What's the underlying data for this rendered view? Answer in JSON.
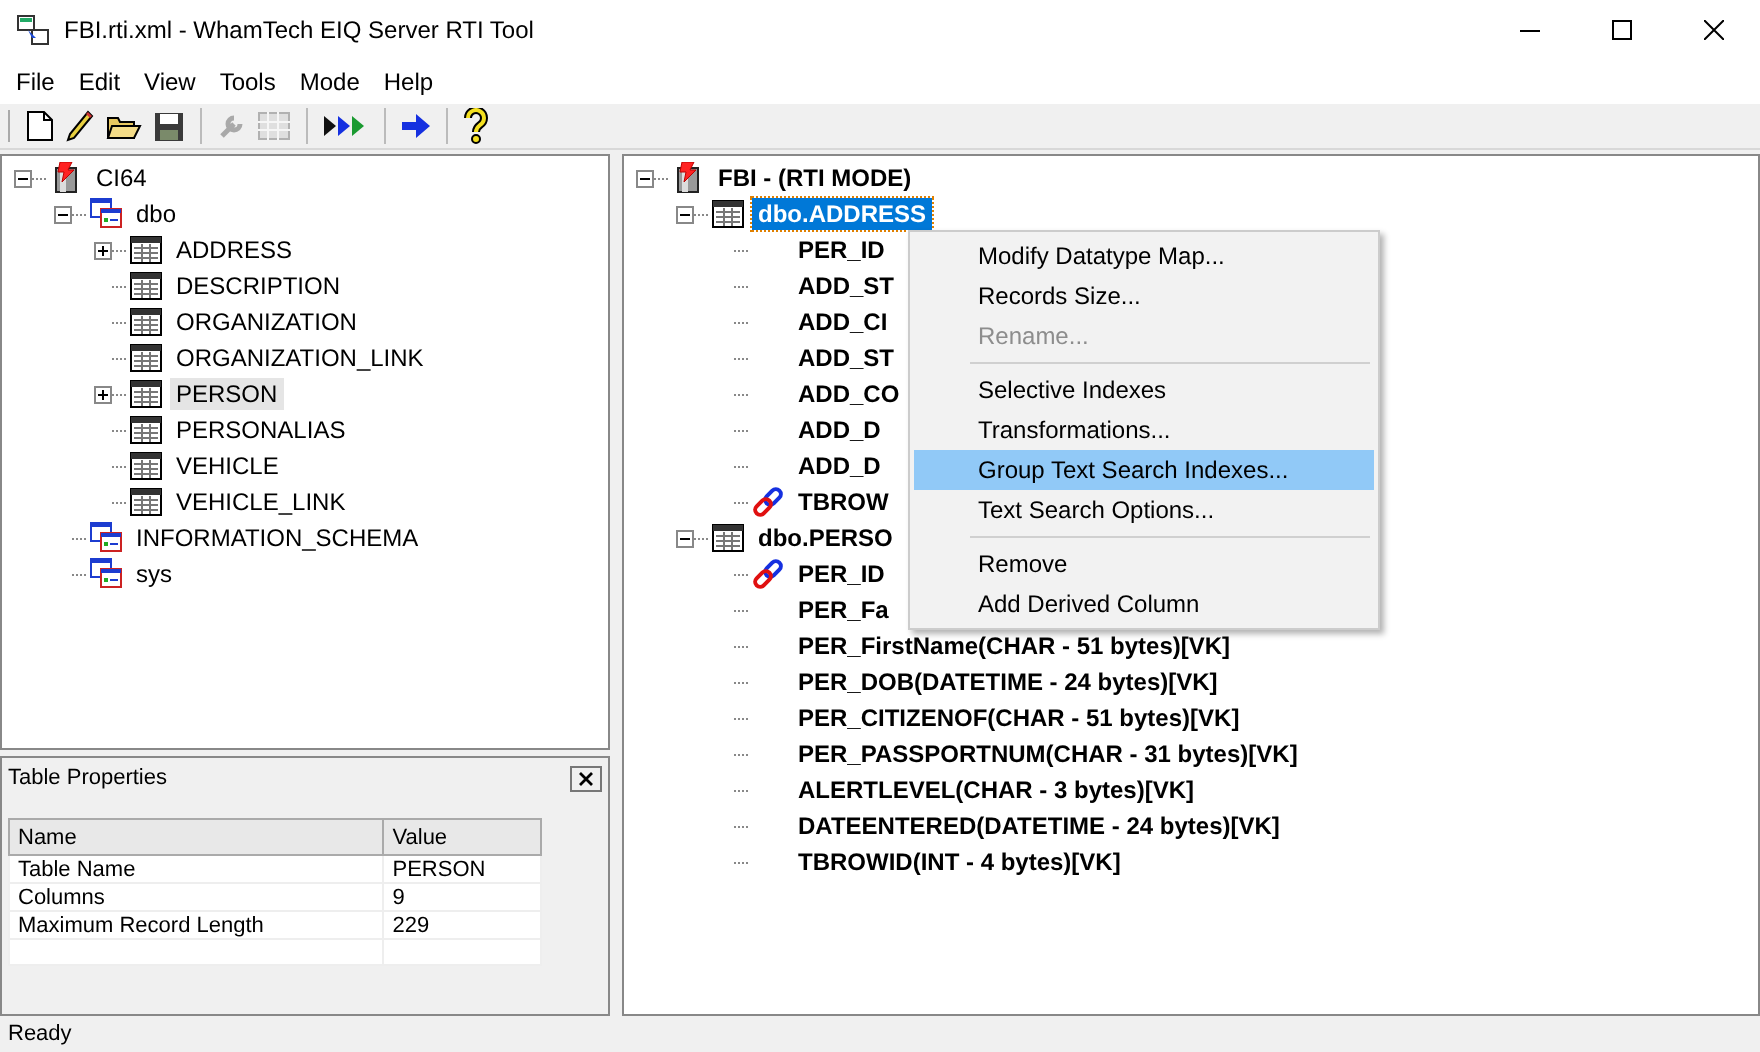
{
  "window": {
    "title": "FBI.rti.xml - WhamTech EIQ Server RTI Tool"
  },
  "menu_bar": [
    "File",
    "Edit",
    "View",
    "Tools",
    "Mode",
    "Help"
  ],
  "toolbar": [
    {
      "kind": "new",
      "disabled": false
    },
    {
      "kind": "edit",
      "disabled": false
    },
    {
      "kind": "open",
      "disabled": false
    },
    {
      "kind": "save",
      "disabled": false
    },
    {
      "kind": "sep"
    },
    {
      "kind": "wrench",
      "disabled": true
    },
    {
      "kind": "grid",
      "disabled": true
    },
    {
      "kind": "sep"
    },
    {
      "kind": "run-all",
      "disabled": false
    },
    {
      "kind": "sep"
    },
    {
      "kind": "run",
      "disabled": false
    },
    {
      "kind": "sep"
    },
    {
      "kind": "help",
      "disabled": false
    }
  ],
  "left_tree": [
    {
      "label": "CI64",
      "kind": "database",
      "expanded": true,
      "selected": false,
      "children": [
        {
          "label": "dbo",
          "kind": "schema",
          "expanded": true,
          "selected": false,
          "children": [
            {
              "label": "ADDRESS",
              "kind": "table",
              "expanded": false,
              "selected": false
            },
            {
              "label": "DESCRIPTION",
              "kind": "table",
              "selected": false
            },
            {
              "label": "ORGANIZATION",
              "kind": "table",
              "selected": false
            },
            {
              "label": "ORGANIZATION_LINK",
              "kind": "table",
              "selected": false
            },
            {
              "label": "PERSON",
              "kind": "table",
              "expanded": false,
              "selected": true
            },
            {
              "label": "PERSONALIAS",
              "kind": "table",
              "selected": false
            },
            {
              "label": "VEHICLE",
              "kind": "table",
              "selected": false
            },
            {
              "label": "VEHICLE_LINK",
              "kind": "table",
              "selected": false
            }
          ]
        },
        {
          "label": "INFORMATION_SCHEMA",
          "kind": "schema",
          "selected": false
        },
        {
          "label": "sys",
          "kind": "schema",
          "selected": false
        }
      ]
    }
  ],
  "properties_panel": {
    "title": "Table Properties",
    "columns": [
      "Name",
      "Value"
    ],
    "rows": [
      [
        "Table Name",
        "PERSON"
      ],
      [
        "Columns",
        "9"
      ],
      [
        "Maximum Record Length",
        "229"
      ]
    ]
  },
  "right_tree": [
    {
      "label": "FBI   - (RTI MODE)",
      "kind": "database",
      "expanded": true,
      "selected": false,
      "children": [
        {
          "label": "dbo.ADDRESS",
          "kind": "table",
          "expanded": true,
          "selected": true,
          "children": [
            {
              "label": "PER_ID",
              "kind": "column",
              "selected": false
            },
            {
              "label": "ADD_ST",
              "kind": "column",
              "selected": false
            },
            {
              "label": "ADD_CI",
              "kind": "column",
              "selected": false
            },
            {
              "label": "ADD_ST",
              "kind": "column",
              "selected": false
            },
            {
              "label": "ADD_CO",
              "kind": "column",
              "selected": false
            },
            {
              "label": "ADD_D",
              "kind": "column",
              "selected": false
            },
            {
              "label": "ADD_D",
              "kind": "column",
              "selected": false
            },
            {
              "label": "TBROW",
              "kind": "key",
              "selected": false
            }
          ]
        },
        {
          "label": "dbo.PERSO",
          "kind": "table",
          "expanded": true,
          "selected": false,
          "children": [
            {
              "label": "PER_ID",
              "kind": "key",
              "selected": false
            },
            {
              "label": "PER_Fa",
              "kind": "column",
              "selected": false
            },
            {
              "label": "PER_FirstName(CHAR - 51 bytes)[VK]",
              "kind": "column",
              "selected": false
            },
            {
              "label": "PER_DOB(DATETIME - 24 bytes)[VK]",
              "kind": "column",
              "selected": false
            },
            {
              "label": "PER_CITIZENOF(CHAR - 51 bytes)[VK]",
              "kind": "column",
              "selected": false
            },
            {
              "label": "PER_PASSPORTNUM(CHAR - 31 bytes)[VK]",
              "kind": "column",
              "selected": false
            },
            {
              "label": "ALERTLEVEL(CHAR - 3 bytes)[VK]",
              "kind": "column",
              "selected": false
            },
            {
              "label": "DATEENTERED(DATETIME - 24 bytes)[VK]",
              "kind": "column",
              "selected": false
            },
            {
              "label": "TBROWID(INT - 4 bytes)[VK]",
              "kind": "column",
              "selected": false
            }
          ]
        }
      ]
    }
  ],
  "context_menu": [
    {
      "kind": "item",
      "label": "Modify Datatype Map...",
      "disabled": false,
      "selected": false
    },
    {
      "kind": "item",
      "label": "Records Size...",
      "disabled": false,
      "selected": false
    },
    {
      "kind": "item",
      "label": "Rename...",
      "disabled": true,
      "selected": false
    },
    {
      "kind": "separator"
    },
    {
      "kind": "item",
      "label": "Selective Indexes",
      "disabled": false,
      "selected": false
    },
    {
      "kind": "item",
      "label": "Transformations...",
      "disabled": false,
      "selected": false
    },
    {
      "kind": "item",
      "label": "Group Text Search Indexes...",
      "disabled": false,
      "selected": true
    },
    {
      "kind": "item",
      "label": "Text Search Options...",
      "disabled": false,
      "selected": false
    },
    {
      "kind": "separator"
    },
    {
      "kind": "item",
      "label": "Remove",
      "disabled": false,
      "selected": false
    },
    {
      "kind": "item",
      "label": "Add Derived Column",
      "disabled": false,
      "selected": false
    }
  ],
  "status_bar": "Ready"
}
